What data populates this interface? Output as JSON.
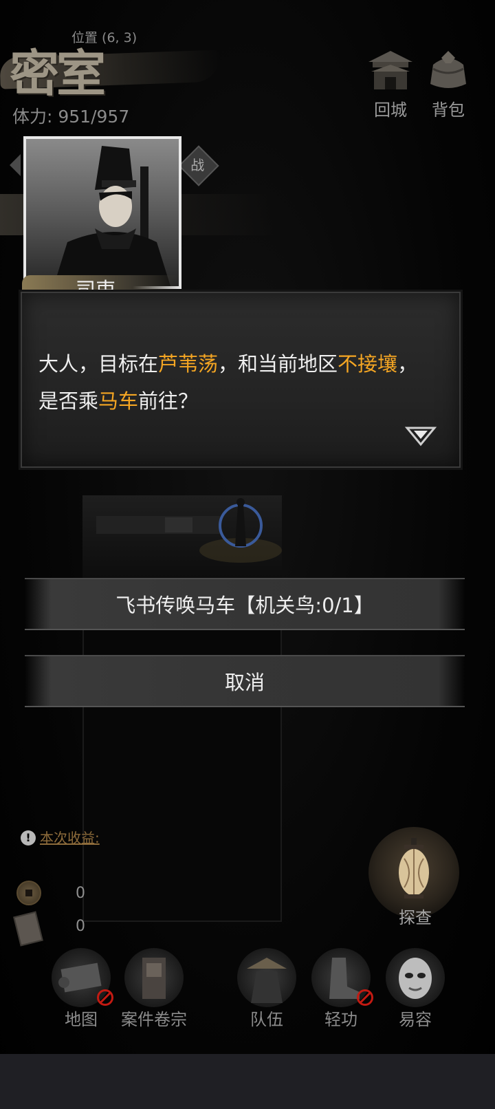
{
  "location": {
    "coord": "位置 (6, 3)",
    "name": "密室",
    "stamina": "体力: 951/957"
  },
  "top_buttons": [
    {
      "label": "回城",
      "icon": "city-gate-icon"
    },
    {
      "label": "背包",
      "icon": "bundle-icon"
    }
  ],
  "battle_badge": "战",
  "speaker": {
    "name": "司吏"
  },
  "dialog": {
    "parts": [
      {
        "text": "大人，目标在",
        "highlight": false
      },
      {
        "text": "芦苇荡",
        "highlight": true
      },
      {
        "text": "，和当前地区",
        "highlight": false
      },
      {
        "text": "不接壤",
        "highlight": true
      },
      {
        "text": "，是否乘",
        "highlight": false
      },
      {
        "text": "马车",
        "highlight": true
      },
      {
        "text": "前往？",
        "highlight": false
      }
    ]
  },
  "actions": {
    "summon": {
      "prefix": "飞书传唤",
      "highlight": "马车",
      "bracket_open": "【机关鸟:",
      "count": "0/1",
      "bracket_close": "】"
    },
    "cancel": "取消"
  },
  "income": {
    "label": "本次收益:",
    "coins": "0",
    "tickets": "0"
  },
  "explore": {
    "label": "探查",
    "icon": "lantern-icon"
  },
  "nav": [
    {
      "label": "地图",
      "icon": "map-scroll-icon",
      "disabled": true
    },
    {
      "label": "案件卷宗",
      "icon": "case-file-icon",
      "disabled": false
    },
    {
      "label": "队伍",
      "icon": "team-icon",
      "disabled": false
    },
    {
      "label": "轻功",
      "icon": "boots-icon",
      "disabled": true
    },
    {
      "label": "易容",
      "icon": "mask-icon",
      "disabled": false
    }
  ],
  "colors": {
    "highlight": "#f5a623",
    "count": "#ff2a1f",
    "ban": "#c21a12"
  }
}
